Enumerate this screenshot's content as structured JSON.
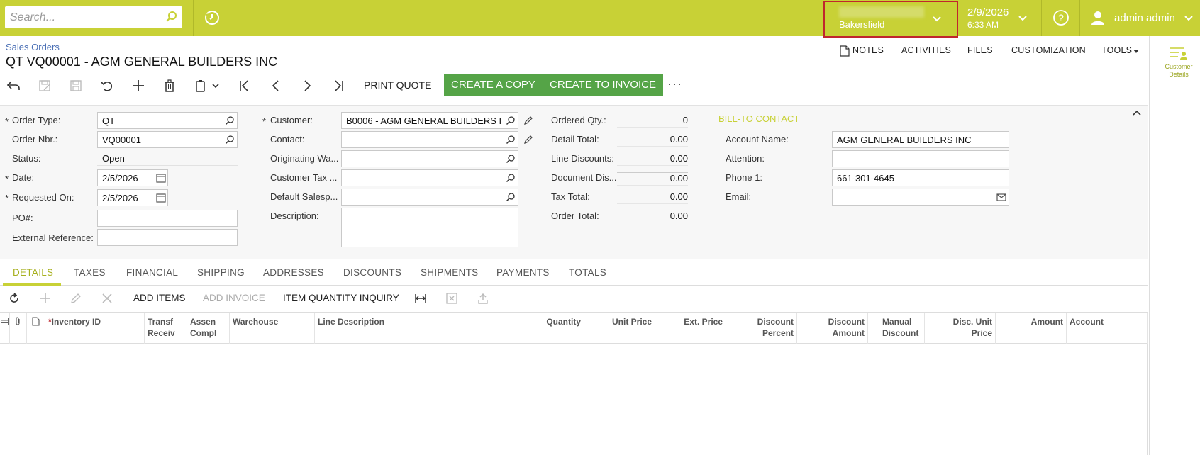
{
  "topbar": {
    "search_placeholder": "Search...",
    "branch": "Bakersfield",
    "date": "2/9/2026",
    "time": "6:33 AM",
    "user": "admin admin"
  },
  "header": {
    "breadcrumb": "Sales Orders",
    "title": "QT VQ00001 - AGM GENERAL BUILDERS INC",
    "links": [
      "NOTES",
      "ACTIVITIES",
      "FILES",
      "CUSTOMIZATION",
      "TOOLS"
    ],
    "side_panel_label": "Customer Details"
  },
  "toolbar": {
    "print_quote": "PRINT QUOTE",
    "create_copy": "CREATE A COPY",
    "create_invoice": "CREATE TO INVOICE",
    "more": "···"
  },
  "form": {
    "left": [
      {
        "label": "Order Type:",
        "value": "QT",
        "required": true
      },
      {
        "label": "Order Nbr.:",
        "value": "VQ00001",
        "required": false
      },
      {
        "label": "Status:",
        "value": "Open",
        "required": false
      },
      {
        "label": "Date:",
        "value": "2/5/2026",
        "required": true
      },
      {
        "label": "Requested On:",
        "value": "2/5/2026",
        "required": true
      },
      {
        "label": "PO#:",
        "value": "",
        "required": false
      },
      {
        "label": "External Reference:",
        "value": "",
        "required": false
      }
    ],
    "middle": [
      {
        "label": "Customer:",
        "value": "B0006 - AGM GENERAL BUILDERS I",
        "required": true
      },
      {
        "label": "Contact:",
        "value": ""
      },
      {
        "label": "Originating Wa...",
        "value": ""
      },
      {
        "label": "Customer Tax ...",
        "value": ""
      },
      {
        "label": "Default Salesp...",
        "value": ""
      },
      {
        "label": "Description:",
        "value": ""
      }
    ],
    "totals": [
      {
        "label": "Ordered Qty.:",
        "value": "0"
      },
      {
        "label": "Detail Total:",
        "value": "0.00"
      },
      {
        "label": "Line Discounts:",
        "value": "0.00"
      },
      {
        "label": "Document Dis...",
        "value": "0.00"
      },
      {
        "label": "Tax Total:",
        "value": "0.00"
      },
      {
        "label": "Order Total:",
        "value": "0.00"
      }
    ],
    "bill_to": {
      "heading": "BILL-TO CONTACT",
      "fields": [
        {
          "label": "Account Name:",
          "value": "AGM GENERAL BUILDERS INC"
        },
        {
          "label": "Attention:",
          "value": ""
        },
        {
          "label": "Phone 1:",
          "value": "661-301-4645"
        },
        {
          "label": "Email:",
          "value": ""
        }
      ]
    }
  },
  "tabs": [
    "DETAILS",
    "TAXES",
    "FINANCIAL",
    "SHIPPING",
    "ADDRESSES",
    "DISCOUNTS",
    "SHIPMENTS",
    "PAYMENTS",
    "TOTALS"
  ],
  "grid_toolbar": {
    "add_items": "ADD ITEMS",
    "add_invoice": "ADD INVOICE",
    "item_qty_inquiry": "ITEM QUANTITY INQUIRY"
  },
  "grid_columns": [
    {
      "l1": "Inventory ID",
      "l2": ""
    },
    {
      "l1": "Transf",
      "l2": "Receiv"
    },
    {
      "l1": "Assen",
      "l2": "Compl"
    },
    {
      "l1": "Warehouse",
      "l2": ""
    },
    {
      "l1": "Line Description",
      "l2": ""
    },
    {
      "l1": "Quantity",
      "l2": ""
    },
    {
      "l1": "Unit Price",
      "l2": ""
    },
    {
      "l1": "Ext. Price",
      "l2": ""
    },
    {
      "l1": "Discount",
      "l2": "Percent"
    },
    {
      "l1": "Discount",
      "l2": "Amount"
    },
    {
      "l1": "Manual",
      "l2": "Discount"
    },
    {
      "l1": "Disc. Unit",
      "l2": "Price"
    },
    {
      "l1": "Amount",
      "l2": ""
    },
    {
      "l1": "Account",
      "l2": ""
    }
  ]
}
